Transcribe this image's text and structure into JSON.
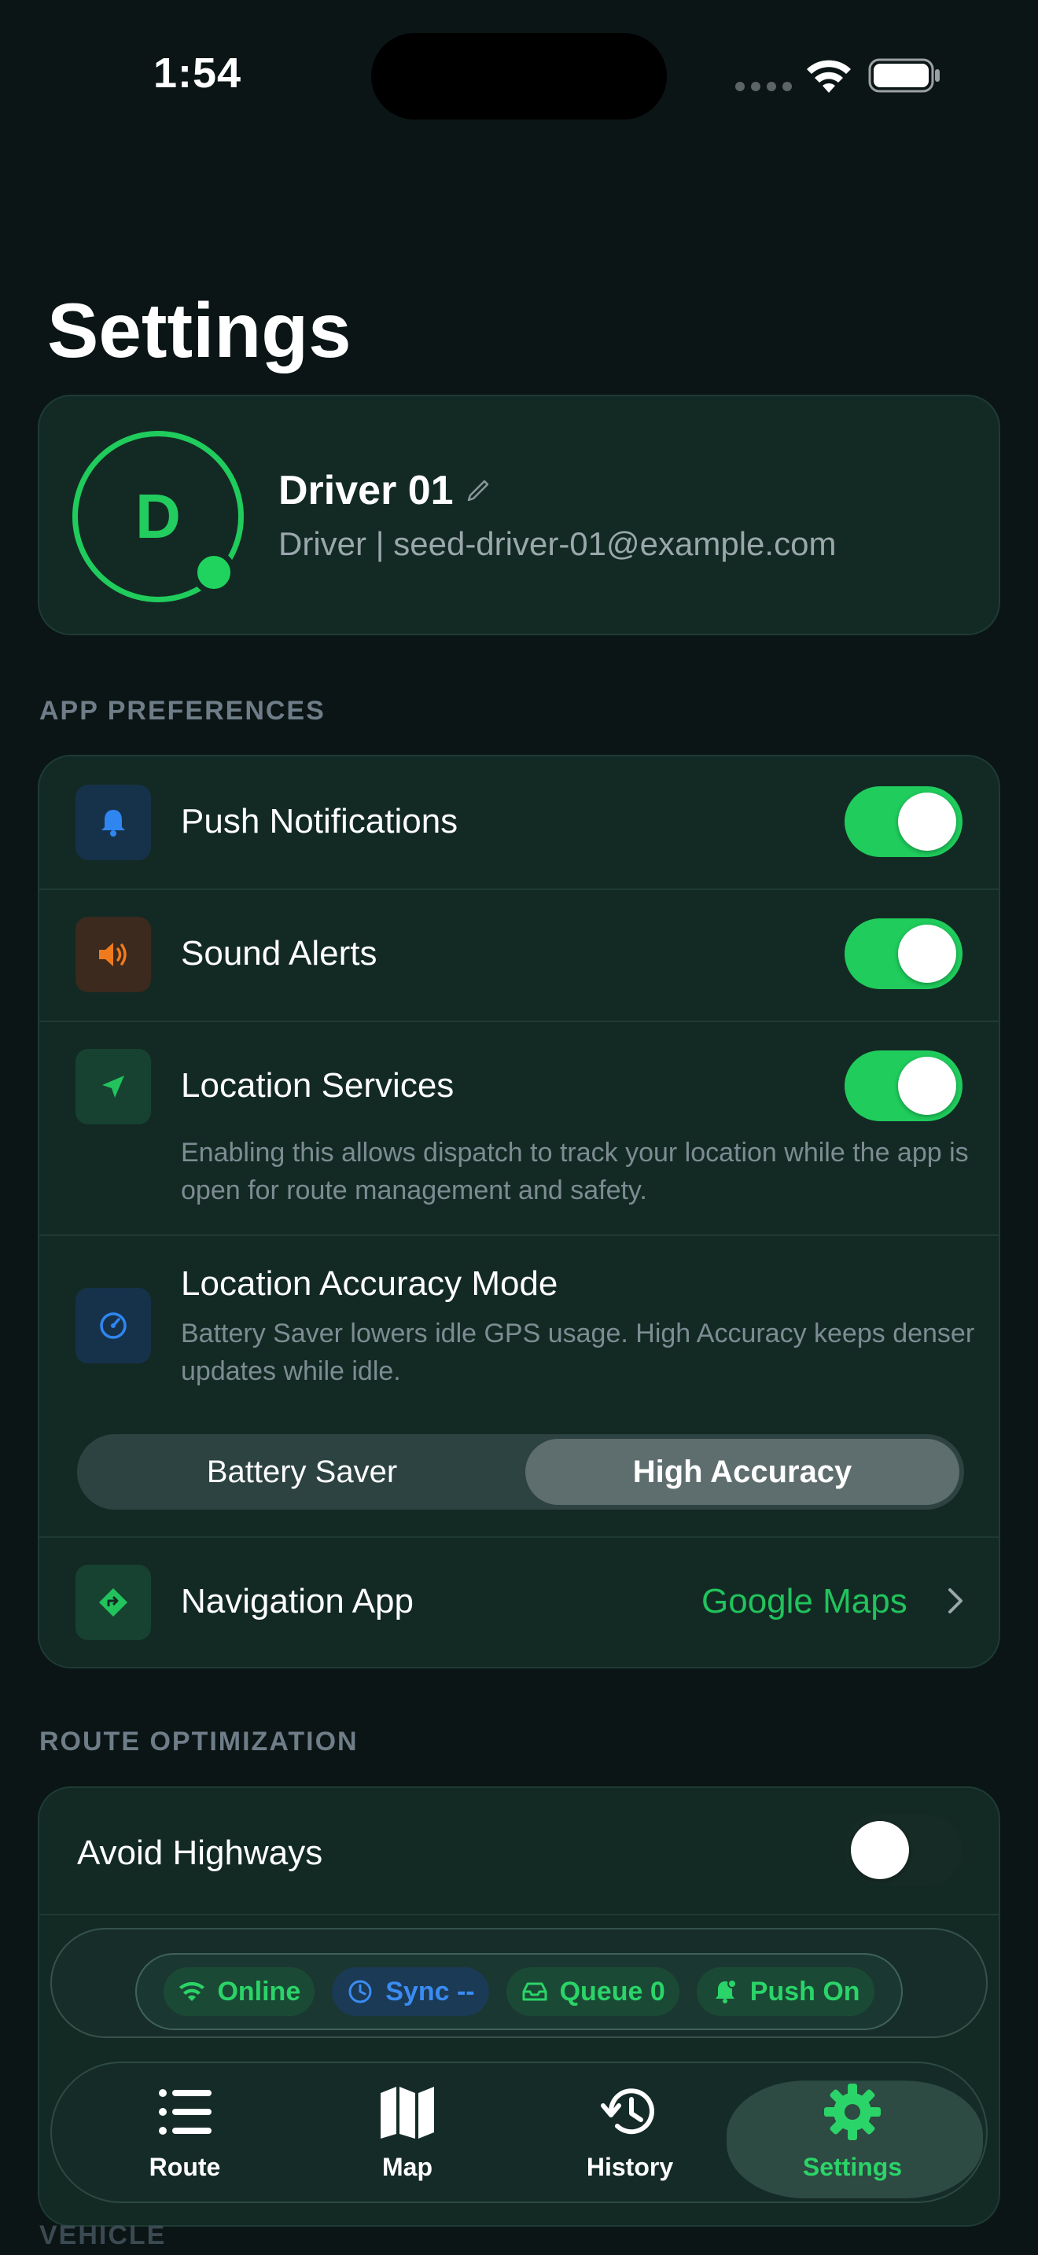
{
  "status": {
    "time": "1:54"
  },
  "page": {
    "title": "Settings"
  },
  "profile": {
    "initial": "D",
    "name": "Driver 01",
    "subtitle": "Driver | seed-driver-01@example.com"
  },
  "sections": {
    "app_preferences": "APP PREFERENCES",
    "route_optimization": "ROUTE OPTIMIZATION",
    "vehicle": "VEHICLE"
  },
  "preferences": {
    "push": {
      "label": "Push Notifications",
      "enabled": true
    },
    "sound": {
      "label": "Sound Alerts",
      "enabled": true
    },
    "location": {
      "label": "Location Services",
      "enabled": true,
      "description": "Enabling this allows dispatch to track your location while the app is open for route management and safety."
    },
    "accuracy": {
      "label": "Location Accuracy Mode",
      "description": "Battery Saver lowers idle GPS usage. High Accuracy keeps denser updates while idle.",
      "options": [
        "Battery Saver",
        "High Accuracy"
      ],
      "selected": "High Accuracy"
    },
    "navigation": {
      "label": "Navigation App",
      "value": "Google Maps"
    }
  },
  "route": {
    "avoid_highways": {
      "label": "Avoid Highways",
      "enabled": false
    }
  },
  "status_chips": {
    "online": "Online",
    "sync": "Sync --",
    "queue": "Queue 0",
    "push": "Push On"
  },
  "tabs": [
    {
      "label": "Route"
    },
    {
      "label": "Map"
    },
    {
      "label": "History"
    },
    {
      "label": "Settings",
      "active": true
    }
  ],
  "colors": {
    "background": "#0b1515",
    "card": "#132a24",
    "accent_green": "#1fcc5c",
    "accent_blue": "#3a8cf2",
    "accent_orange": "#f07a1e"
  }
}
